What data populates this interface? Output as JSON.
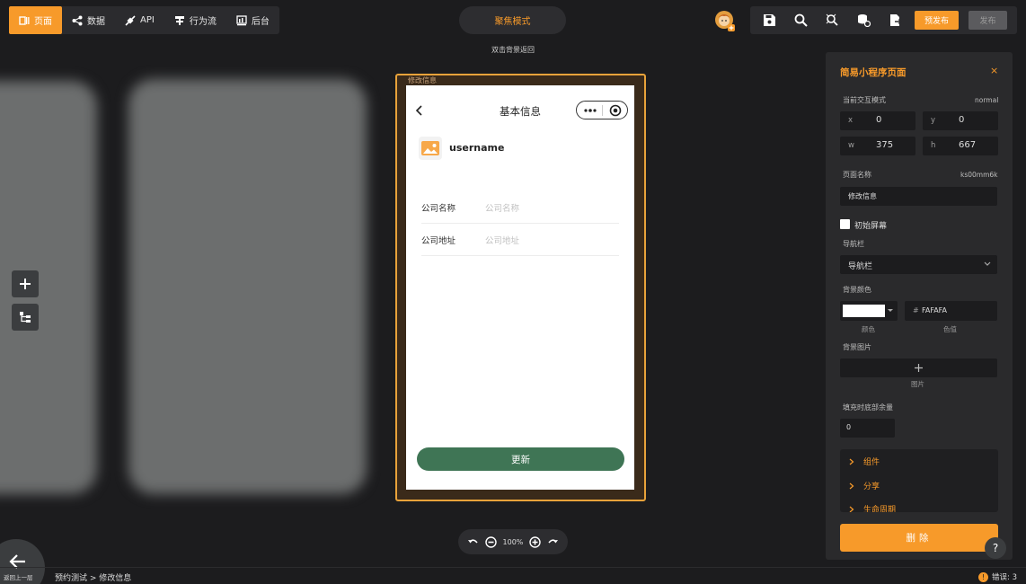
{
  "topnav": {
    "items": [
      {
        "label": "页面",
        "icon": "page-icon",
        "active": true
      },
      {
        "label": "数据",
        "icon": "data-icon",
        "active": false
      },
      {
        "label": "API",
        "icon": "api-icon",
        "active": false
      },
      {
        "label": "行为流",
        "icon": "flow-icon",
        "active": false
      },
      {
        "label": "后台",
        "icon": "backend-icon",
        "active": false
      }
    ],
    "focus_mode": "聚焦模式",
    "hint": "双击背景返回",
    "pre_publish": "预发布",
    "publish": "发布"
  },
  "canvas": {
    "page_label": "修改信息",
    "zoom": "100%",
    "back_label": "返回上一层"
  },
  "phone": {
    "title": "基本信息",
    "username": "username",
    "fields": [
      {
        "label": "公司名称",
        "placeholder": "公司名称"
      },
      {
        "label": "公司地址",
        "placeholder": "公司地址"
      }
    ],
    "update_button": "更新",
    "colors": {
      "button": "#3f7555"
    }
  },
  "panel": {
    "title": "简易小程序页面",
    "close": "×",
    "interaction_mode_label": "当前交互模式",
    "interaction_mode_value": "normal",
    "x": "0",
    "y": "0",
    "w": "375",
    "h": "667",
    "page_name_label": "页面名称",
    "page_id": "ks00mm6k",
    "page_name_value": "修改信息",
    "initial_screen": "初始屏幕",
    "navbar_label": "导航栏",
    "navbar_value": "导航栏",
    "bg_color_label": "背景颜色",
    "color_hex_prefix": "#",
    "color_hex": "FAFAFA",
    "color_caption": "颜色",
    "color_value_caption": "色值",
    "bg_image_label": "背景图片",
    "image_caption": "图片",
    "fill_bottom_label": "填充时底部余量",
    "fill_bottom_value": "0",
    "sections": [
      "组件",
      "分享",
      "生命周期"
    ],
    "delete": "删除"
  },
  "status": {
    "breadcrumb": "预约测试 > 修改信息",
    "errors": "错误: 3"
  },
  "accent": "#f79a2a"
}
